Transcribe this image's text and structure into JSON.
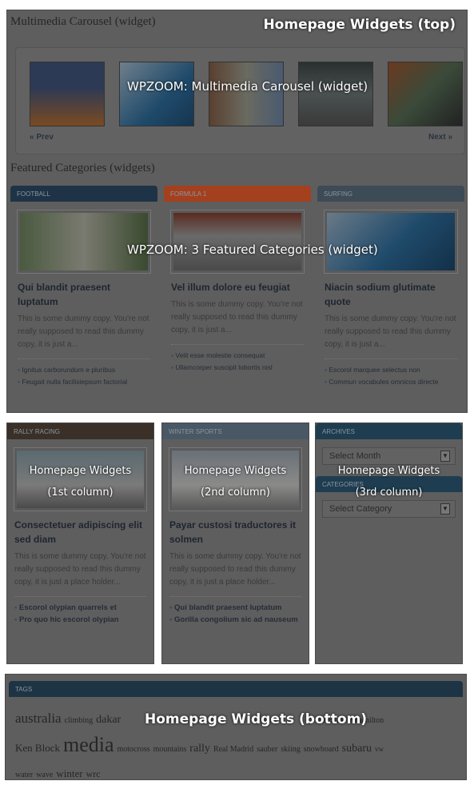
{
  "top": {
    "heading": "Multimedia Carousel (widget)",
    "overlay": "Homepage Widgets (top)",
    "carousel_overlay": "WPZOOM: Multimedia Carousel (widget)",
    "prev": "« Prev",
    "next": "Next »"
  },
  "featured": {
    "heading": "Featured Categories (widgets)",
    "overlay": "WPZOOM: 3 Featured Categories (widget)",
    "cats": [
      {
        "label": "FOOTBALL",
        "color": "#1f3347",
        "title": "Qui blandit praesent luptatum",
        "excerpt": "This is some dummy copy. You're not really supposed to read this dummy copy, it is just a...",
        "links": [
          "Ignitus carborundum e pluribus",
          "Feugait nulla facilisiepsum factorial"
        ]
      },
      {
        "label": "FORMULA 1",
        "color": "#a4401e",
        "title": "Vel illum dolore eu feugiat",
        "excerpt": "This is some dummy copy. You're not really supposed to read this dummy copy, it is just a...",
        "links": [
          "Velit esse molestie consequat",
          "Ullamcorper suscipit lobortis nisl"
        ]
      },
      {
        "label": "SURFING",
        "color": "#3d4b57",
        "title": "Niacin sodium glutimate quote",
        "excerpt": "This is some dummy copy. You're not really supposed to read this dummy copy, it is just a...",
        "links": [
          "Escorol marquee selectus non",
          "Commun vocabules omnicos directe"
        ]
      }
    ]
  },
  "columns": [
    {
      "label": "RALLY RACING",
      "color": "#3a3028",
      "overlay1": "Homepage Widgets",
      "overlay2": "(1st column)",
      "title": "Consectetuer adipiscing elit sed diam",
      "excerpt": "This is some dummy copy. You're not really supposed to read this dummy copy, it is just a place holder...",
      "links": [
        "Escorol olypian quarrels et",
        "Pro quo hic escorol olypian"
      ]
    },
    {
      "label": "WINTER SPORTS",
      "color": "#4a5865",
      "overlay1": "Homepage Widgets",
      "overlay2": "(2nd column)",
      "title": "Payar custosi traductores it solmen",
      "excerpt": "This is some dummy copy. You're not really supposed to read this dummy copy, it is just a place holder...",
      "links": [
        "Qui blandit praesent luptatum",
        "Gorilla congolium sic ad nauseum"
      ]
    },
    {
      "overlay1": "Homepage Widgets",
      "overlay2": "(3rd column)",
      "archives_label": "ARCHIVES",
      "archives_select": "Select Month",
      "categories_label": "CATEGORIES",
      "categories_select": "Select Category",
      "color": "#1f3d50"
    }
  ],
  "bottom": {
    "label": "TAGS",
    "overlay": "Homepage Widgets (bottom)",
    "color": "#1d3444",
    "tags": [
      "australia",
      "climbing",
      "dakar",
      "formula 1",
      "Hamilton",
      "Ken Block",
      "media",
      "motocross",
      "mountains",
      "rally",
      "Real Madrid",
      "sauber",
      "skiing",
      "snowboard",
      "subaru",
      "vw",
      "water",
      "wave",
      "winter",
      "wrc"
    ]
  }
}
